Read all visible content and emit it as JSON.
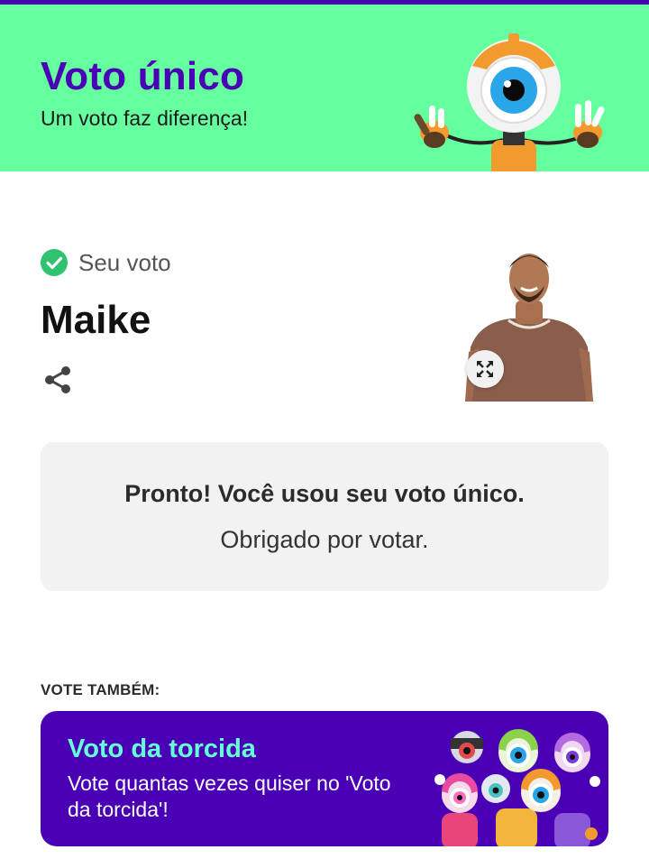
{
  "colors": {
    "accent_purple": "#4a00b4",
    "header_green": "#66ff9f",
    "check_green": "#2fc26f",
    "torcida_title": "#66ffd9",
    "box_gray": "#f2f2f2"
  },
  "header": {
    "title": "Voto único",
    "subtitle": "Um voto faz diferença!",
    "mascot_icon": "big-brother-eye-mascot"
  },
  "vote": {
    "status_label": "Seu voto",
    "status_icon": "check-circle-icon",
    "candidate_name": "Maike",
    "share_icon": "share-icon",
    "expand_icon": "expand-icon"
  },
  "confirmation": {
    "title": "Pronto! Você usou seu voto único.",
    "subtitle": "Obrigado por votar."
  },
  "also_vote": {
    "label": "VOTE TAMBÉM:",
    "card": {
      "title": "Voto da torcida",
      "description": "Vote quantas vezes quiser no 'Voto da torcida'!"
    }
  }
}
